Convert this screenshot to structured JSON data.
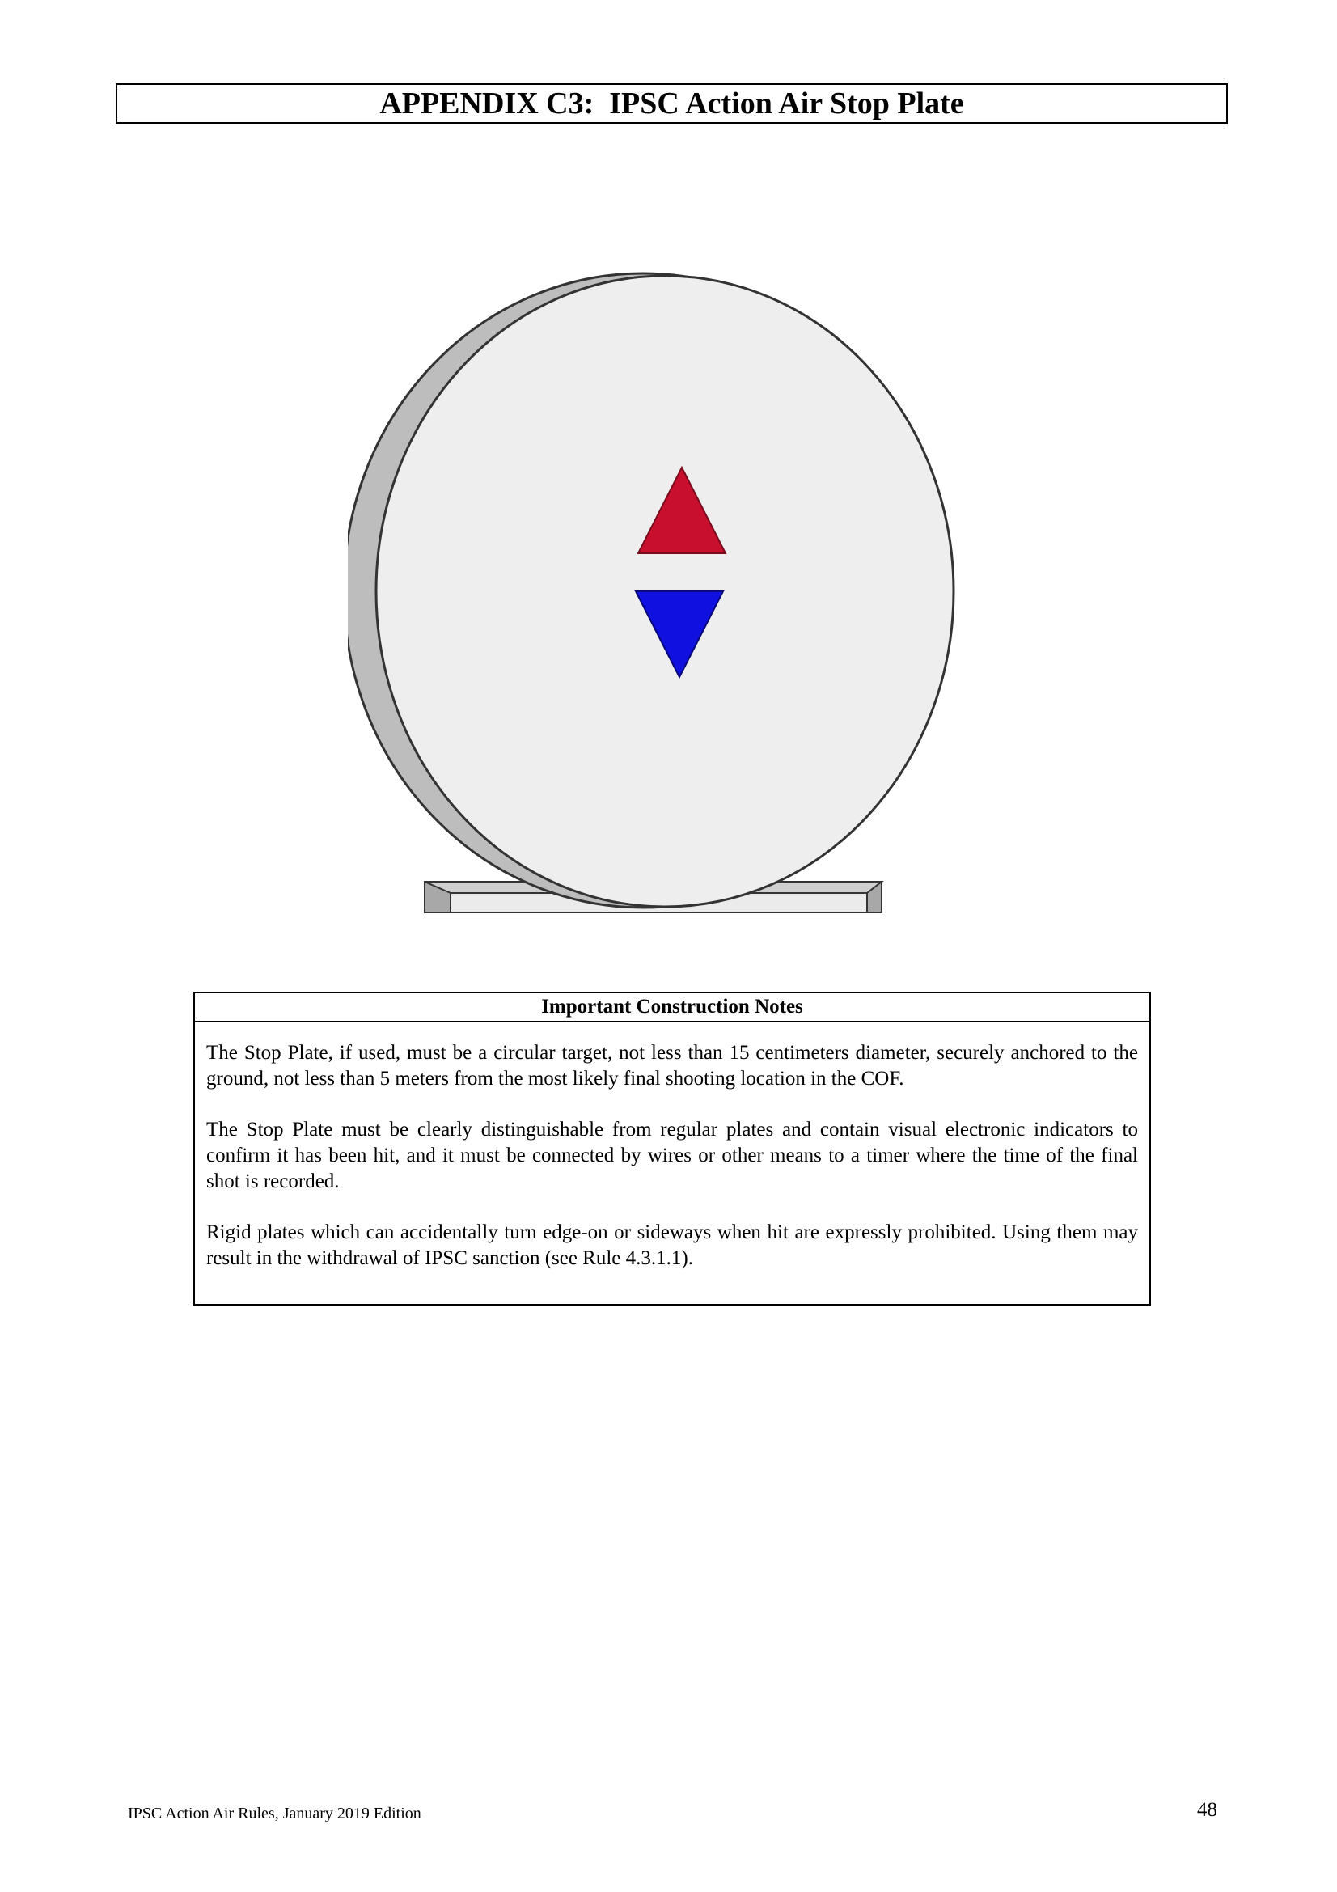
{
  "header": {
    "title": "APPENDIX C3:  IPSC Action Air Stop Plate"
  },
  "figure": {
    "icons": [
      "stop-plate-disc",
      "red-up-triangle-indicator",
      "blue-down-triangle-indicator",
      "base-stand"
    ],
    "colors": {
      "plate_face": "#eeeeef",
      "plate_edge": "#bdbdbd",
      "outline": "#333333",
      "up_indicator": "#c8102e",
      "down_indicator": "#1010e0",
      "base_face": "#ebebeb",
      "base_side": "#a8a8a8"
    }
  },
  "notes": {
    "heading": "Important Construction Notes",
    "paragraphs": [
      "The Stop Plate, if used, must be a circular target, not less than 15 centimeters diameter, securely anchored to the ground, not less than 5 meters from the most likely final shooting location in the COF.",
      "The Stop Plate must be clearly distinguishable from regular plates and contain visual electronic indicators to confirm it has been hit, and it must be connected by wires or other means to a timer where the time of the final shot is recorded.",
      "Rigid plates which can accidentally turn edge-on or sideways when hit are expressly prohibited.  Using them may result in the withdrawal of IPSC sanction (see Rule 4.3.1.1)."
    ]
  },
  "footer": {
    "left_text": "IPSC Action Air Rules, January 2019 Edition",
    "page_number": "48"
  }
}
